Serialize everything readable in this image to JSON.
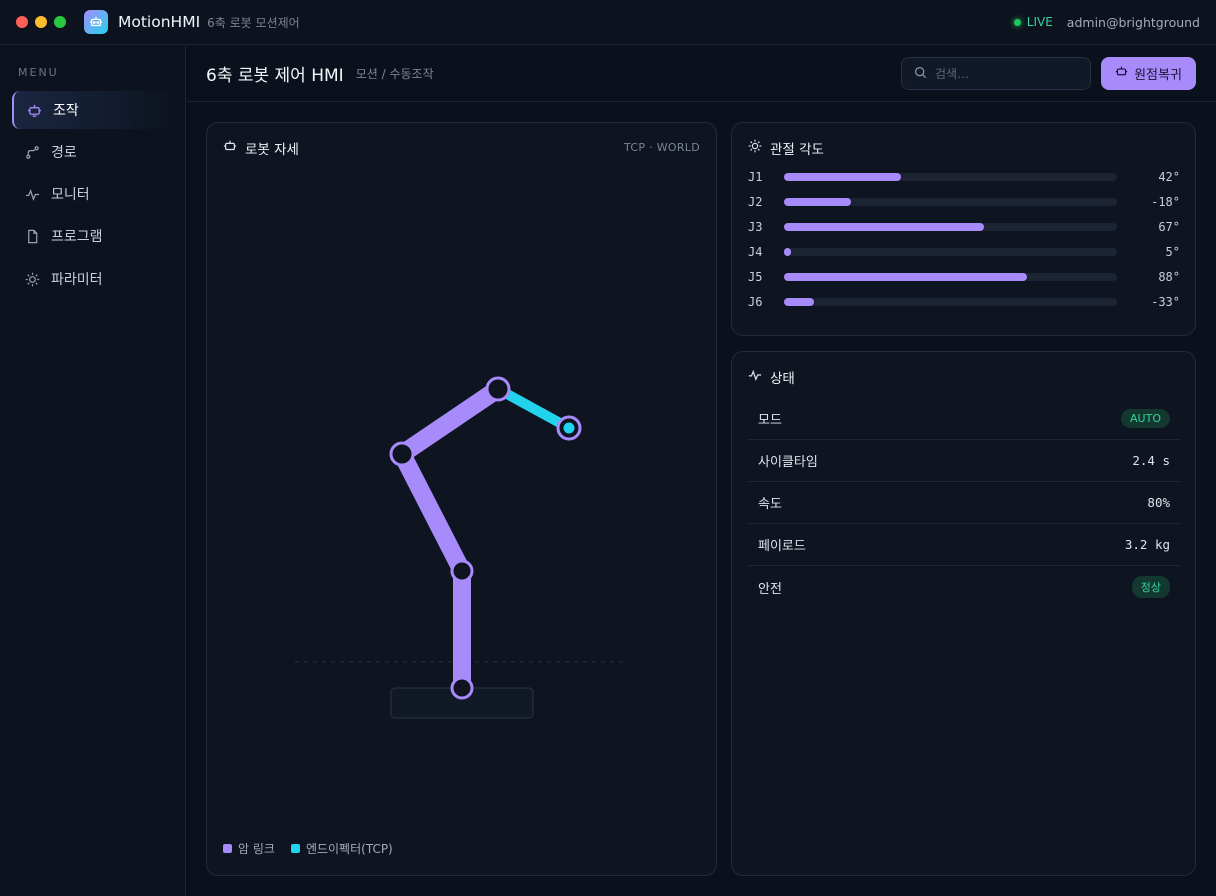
{
  "app": {
    "name": "MotionHMI",
    "subtitle": "6축 로봇 모션제어",
    "live_label": "LIVE",
    "user": "admin@brightground",
    "accent": "#a78bfa",
    "tcp_color": "#22d3ee"
  },
  "sidebar": {
    "menu_label": "MENU",
    "items": [
      {
        "label": "조작",
        "icon": "robot-icon",
        "active": true
      },
      {
        "label": "경로",
        "icon": "route-icon",
        "active": false
      },
      {
        "label": "모니터",
        "icon": "pulse-icon",
        "active": false
      },
      {
        "label": "프로그램",
        "icon": "file-icon",
        "active": false
      },
      {
        "label": "파라미터",
        "icon": "sun-gear-icon",
        "active": false
      }
    ]
  },
  "header": {
    "title": "6축 로봇 제어 HMI",
    "breadcrumb": "모션 / 수동조작",
    "search_placeholder": "검색…",
    "home_button": "원점복귀"
  },
  "pose_panel": {
    "title": "로봇 자세",
    "frame": "TCP · WORLD",
    "legend": [
      "암 링크",
      "엔드이펙터(TCP)"
    ]
  },
  "joints_panel": {
    "title": "관절 각도",
    "joints": [
      {
        "name": "J1",
        "value": "42°",
        "fill": 0.35
      },
      {
        "name": "J2",
        "value": "-18°",
        "fill": 0.2
      },
      {
        "name": "J3",
        "value": "67°",
        "fill": 0.6
      },
      {
        "name": "J4",
        "value": "5°",
        "fill": 0.02
      },
      {
        "name": "J5",
        "value": "88°",
        "fill": 0.73
      },
      {
        "name": "J6",
        "value": "-33°",
        "fill": 0.09
      }
    ]
  },
  "status_panel": {
    "title": "상태",
    "rows": [
      {
        "key": "모드",
        "value": "AUTO",
        "badge": true
      },
      {
        "key": "사이클타임",
        "value": "2.4 s",
        "badge": false
      },
      {
        "key": "속도",
        "value": "80%",
        "badge": false
      },
      {
        "key": "페이로드",
        "value": "3.2 kg",
        "badge": false
      },
      {
        "key": "안전",
        "value": "정상",
        "badge": true
      }
    ]
  }
}
